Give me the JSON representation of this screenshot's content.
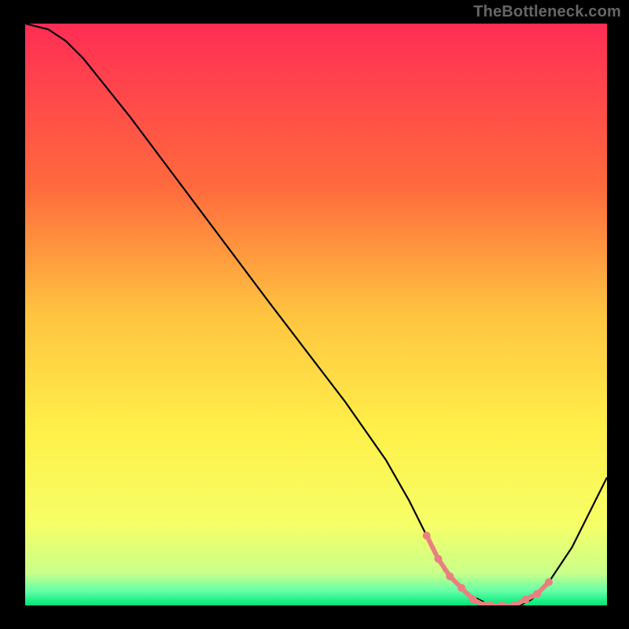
{
  "watermark": "TheBottleneck.com",
  "chart_data": {
    "type": "line",
    "title": "",
    "xlabel": "",
    "ylabel": "",
    "xlim": [
      0,
      100
    ],
    "ylim": [
      0,
      100
    ],
    "background_gradient_stops": [
      {
        "offset": 0.0,
        "color": "#ff2d55"
      },
      {
        "offset": 0.28,
        "color": "#ff6a3d"
      },
      {
        "offset": 0.5,
        "color": "#ffc440"
      },
      {
        "offset": 0.7,
        "color": "#fff04a"
      },
      {
        "offset": 0.86,
        "color": "#f6ff66"
      },
      {
        "offset": 0.945,
        "color": "#c9ff8a"
      },
      {
        "offset": 0.975,
        "color": "#66ffa8"
      },
      {
        "offset": 1.0,
        "color": "#00e676"
      }
    ],
    "series": [
      {
        "name": "bottleneck-curve",
        "x": [
          0,
          4,
          7,
          10,
          18,
          30,
          42,
          55,
          62,
          66,
          69,
          72,
          76,
          80,
          83,
          85,
          87,
          90,
          94,
          100
        ],
        "y": [
          100,
          99,
          97,
          94,
          84,
          68,
          52,
          35,
          25,
          18,
          12,
          6,
          2,
          0,
          0,
          0,
          1,
          4,
          10,
          22
        ]
      }
    ],
    "highlight": {
      "name": "optimal-segment",
      "color": "#e98080",
      "points_x": [
        69,
        71,
        73,
        75,
        77,
        79,
        80,
        82,
        84,
        86,
        88,
        90
      ],
      "points_y": [
        12,
        8,
        5,
        3,
        1,
        0,
        0,
        0,
        0,
        1,
        2,
        4
      ]
    }
  }
}
